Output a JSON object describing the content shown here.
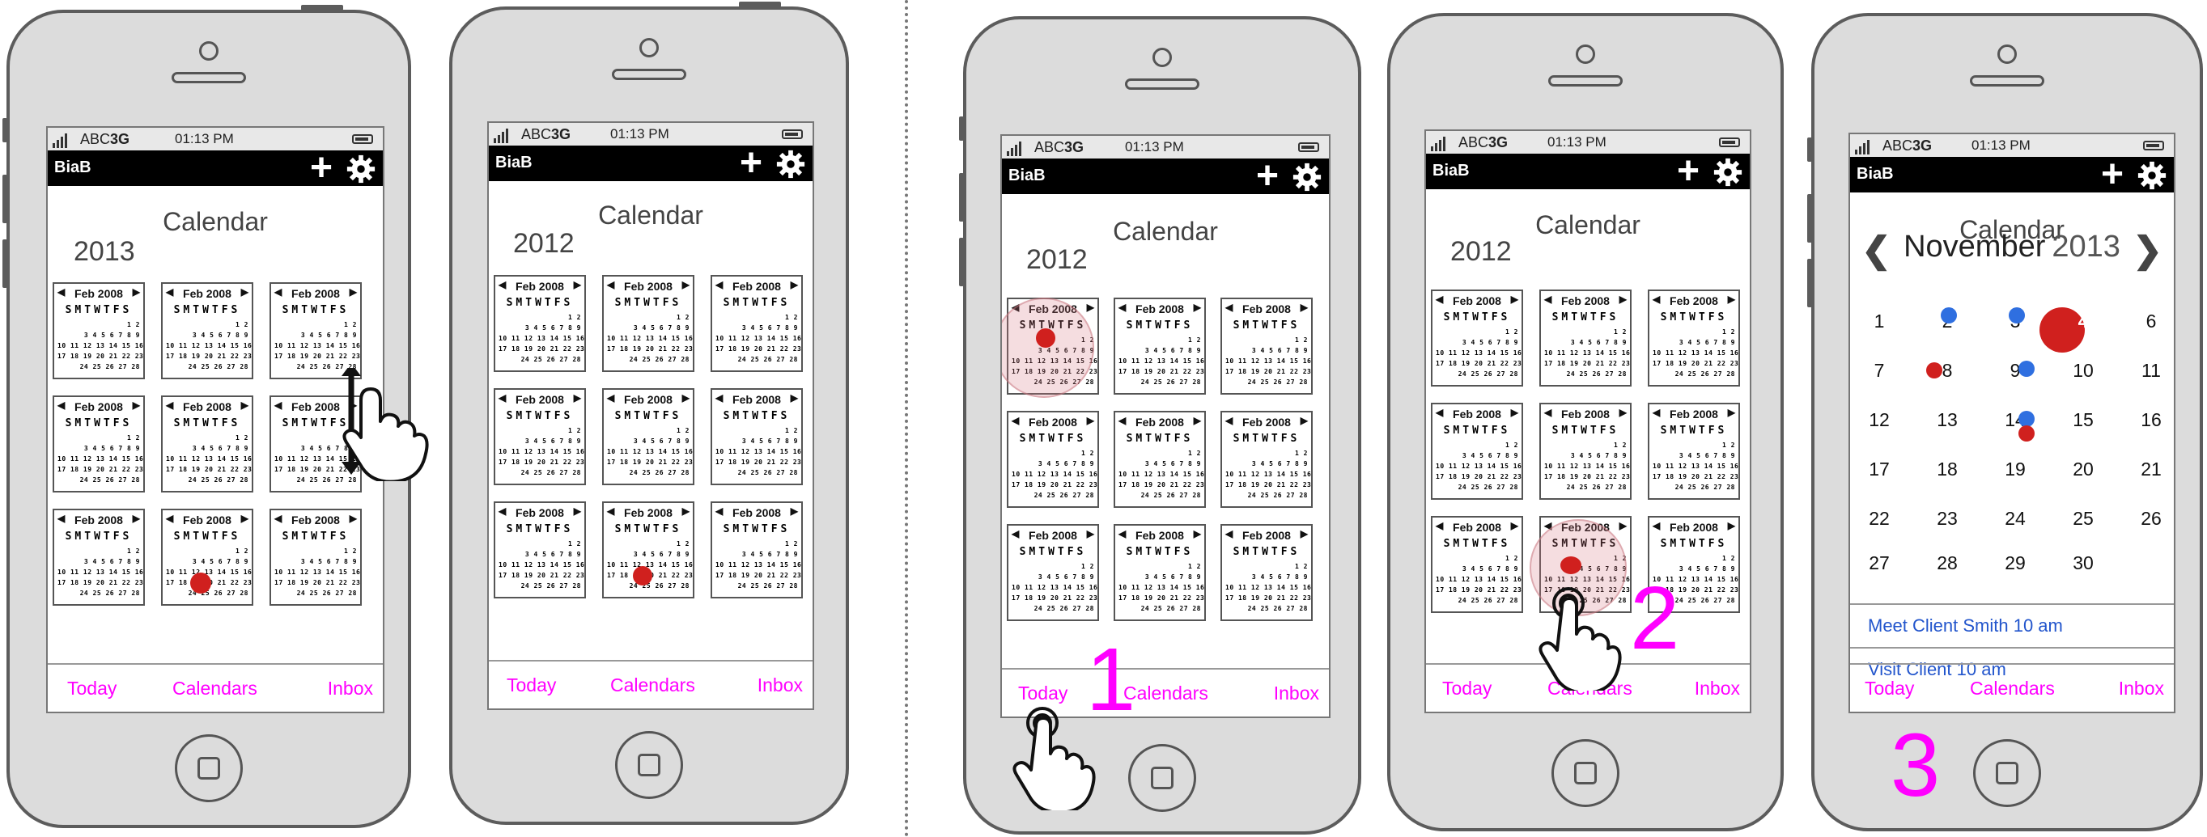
{
  "status_bar": {
    "carrier": "ABC",
    "network": "3G",
    "time": "01:13 PM"
  },
  "app_bar": {
    "name": "BiaB",
    "add_icon": "plus-icon",
    "settings_icon": "gear-icon"
  },
  "screen_title": "Calendar",
  "mini_calendar": {
    "header": "Feb 2008",
    "weekdays": "SMTWTFS",
    "rows": [
      "1 2",
      "3 4 5 6 7 8 9",
      "10 11 12 13 14 15 16",
      "17 18 19 20 21 22 23",
      "24 25 26 27 28"
    ]
  },
  "tabs": {
    "today": "Today",
    "calendars": "Calendars",
    "inbox": "Inbox"
  },
  "phones": [
    {
      "year": "2013"
    },
    {
      "year": "2012"
    },
    {
      "year": "2012",
      "step": "1"
    },
    {
      "year": "2012",
      "step": "2"
    },
    {
      "step": "3",
      "month": "November",
      "month_year": "2013",
      "days": [
        "1",
        "2",
        "3",
        "4",
        "6",
        "7",
        "8",
        "9",
        "10",
        "11",
        "12",
        "13",
        "14",
        "15",
        "16",
        "17",
        "18",
        "19",
        "20",
        "21",
        "22",
        "23",
        "24",
        "25",
        "26",
        "27",
        "28",
        "29",
        "30"
      ],
      "events": [
        "Meet Client Smith 10 am",
        "Visit Client 10 am"
      ]
    }
  ],
  "colors": {
    "accent": "#ff00ff",
    "event_red": "#d0201e",
    "event_blue": "#2f6fe0",
    "appbar": "#000000"
  }
}
